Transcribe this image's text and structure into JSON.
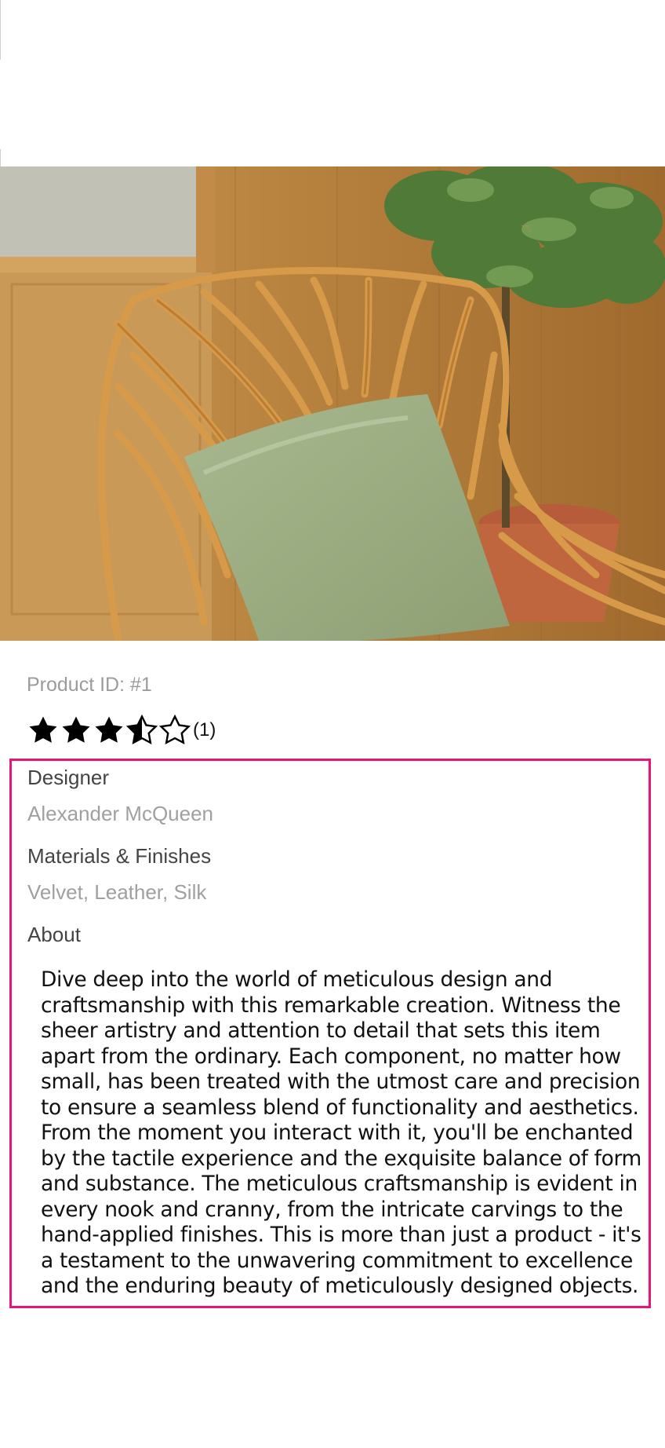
{
  "product": {
    "id_label": "Product ID: #1",
    "rating": {
      "stars": 3.5,
      "max_stars": 5,
      "count_label": "(1)"
    },
    "image_icon": "product-photo-rattan-chair"
  },
  "info": {
    "designer_label": "Designer",
    "designer_value": "Alexander McQueen",
    "materials_label": "Materials & Finishes",
    "materials_value": "Velvet, Leather, Silk",
    "about_label": "About",
    "about_text": "Dive deep into the world of meticulous design and craftsmanship with this remarkable creation. Witness the sheer artistry and attention to detail that sets this item apart from the ordinary. Each component, no matter how small, has been treated with the utmost care and precision to ensure a seamless blend of functionality and aesthetics. From the moment you interact with it, you'll be enchanted by the tactile experience and the exquisite balance of form and substance. The meticulous craftsmanship is evident in every nook and cranny, from the intricate carvings to the hand-applied finishes. This is more than just a product - it's a testament to the unwavering commitment to excellence and the enduring beauty of meticulously designed objects."
  },
  "colors": {
    "highlight_border": "#e6157a",
    "muted_text": "#9b9b9b",
    "label_text": "#444444"
  }
}
